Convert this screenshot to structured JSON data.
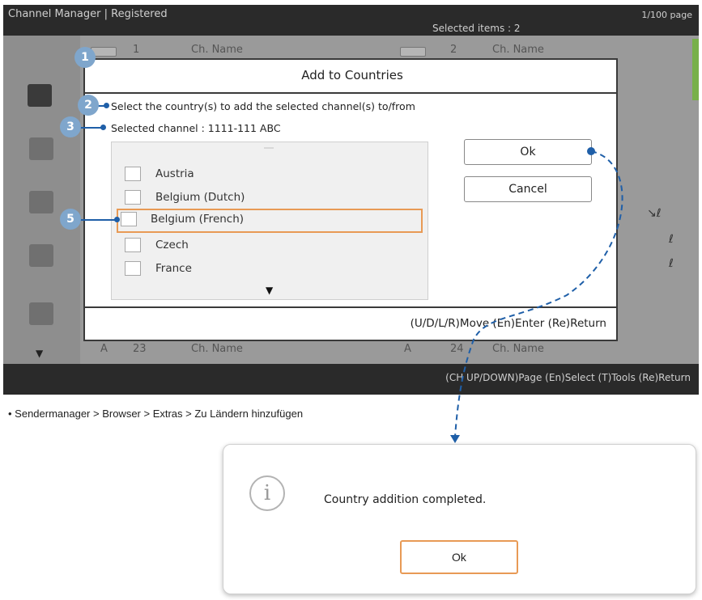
{
  "screen": {
    "title": "Channel Manager | Registered",
    "page_info": "1/100 page",
    "selected_items": "Selected items : 2",
    "list_headers": [
      {
        "num": "1",
        "name": "Ch. Name"
      },
      {
        "num": "2",
        "name": "Ch. Name"
      },
      {
        "num": "23",
        "name": "Ch. Name"
      },
      {
        "num": "24",
        "name": "Ch. Name"
      }
    ],
    "bottom_hint": "(CH UP/DOWN)Page  (En)Select  (T)Tools  (Re)Return",
    "scroll_down_glyph": "▼"
  },
  "dialog": {
    "title": "Add  to Countries",
    "message": "Select the country(s) to add the selected channel(s) to/from",
    "selected_channel": "Selected channel : 1111-111 ABC",
    "countries": [
      {
        "label": "Austria",
        "checked": false
      },
      {
        "label": "Belgium (Dutch)",
        "checked": false
      },
      {
        "label": "Belgium (French)",
        "checked": false
      },
      {
        "label": "Czech",
        "checked": false
      },
      {
        "label": "France",
        "checked": false
      }
    ],
    "focused_country": "Belgium (French)",
    "scroll_down_glyph": "▼",
    "ok_label": "Ok",
    "cancel_label": "Cancel",
    "hint": "(U/D/L/R)Move  (En)Enter  (Re)Return"
  },
  "callouts": [
    "1",
    "2",
    "3",
    "5"
  ],
  "caption": "• Sendermanager > Browser > Extras > Zu Ländern hinzufügen",
  "popup": {
    "icon": "info-icon",
    "icon_glyph": "i",
    "message": "Country addition completed.",
    "ok_label": "Ok"
  },
  "colors": {
    "callout": "#7fa6cc",
    "leader": "#1f5fa8",
    "focus_border": "#e89a55",
    "green_bar": "#78b04a"
  }
}
